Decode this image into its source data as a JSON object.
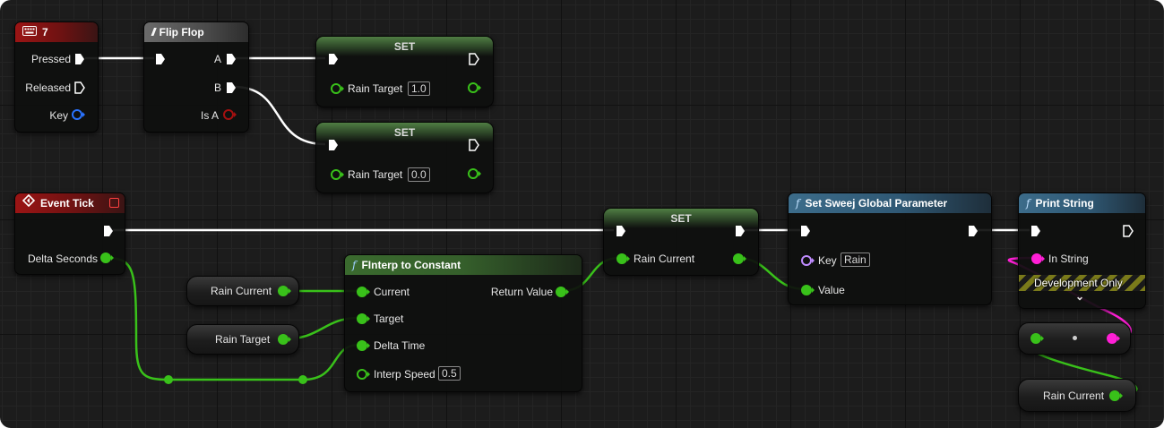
{
  "nodes": {
    "key7": {
      "title": "7",
      "pins": {
        "pressed": "Pressed",
        "released": "Released",
        "key": "Key"
      }
    },
    "flipflop": {
      "title": "Flip Flop",
      "pins": {
        "a": "A",
        "b": "B",
        "isa": "Is A"
      }
    },
    "set1": {
      "title": "SET",
      "var": "Rain Target",
      "value": "1.0"
    },
    "set2": {
      "title": "SET",
      "var": "Rain Target",
      "value": "0.0"
    },
    "event_tick": {
      "title": "Event Tick",
      "pins": {
        "delta": "Delta Seconds"
      }
    },
    "finterp": {
      "title": "FInterp to Constant",
      "pins": {
        "current": "Current",
        "target": "Target",
        "delta": "Delta Time",
        "speed": "Interp Speed",
        "ret": "Return Value"
      },
      "speed_value": "0.5"
    },
    "var_current": {
      "label": "Rain Current"
    },
    "var_target": {
      "label": "Rain Target"
    },
    "set3": {
      "title": "SET",
      "var": "Rain Current"
    },
    "sweej": {
      "title": "Set Sweej Global Parameter",
      "pins": {
        "key": "Key",
        "value": "Value"
      },
      "key_value": "Rain"
    },
    "print": {
      "title": "Print String",
      "pins": {
        "in": "In String"
      },
      "dev_only": "Development Only",
      "expand_glyph": "⌄"
    },
    "var_current2": {
      "label": "Rain Current"
    }
  },
  "colors": {
    "exec": "#ffffff",
    "float": "#39c11a",
    "string": "#ff1fd6",
    "name": "#c08cff",
    "key_struct": "#2a73ff",
    "bool": "#a51010"
  },
  "icons": {
    "keyboard": "keyboard-icon",
    "flipflop": "flipflop-icon",
    "event": "event-diamond-icon",
    "function": "function-f-icon"
  }
}
